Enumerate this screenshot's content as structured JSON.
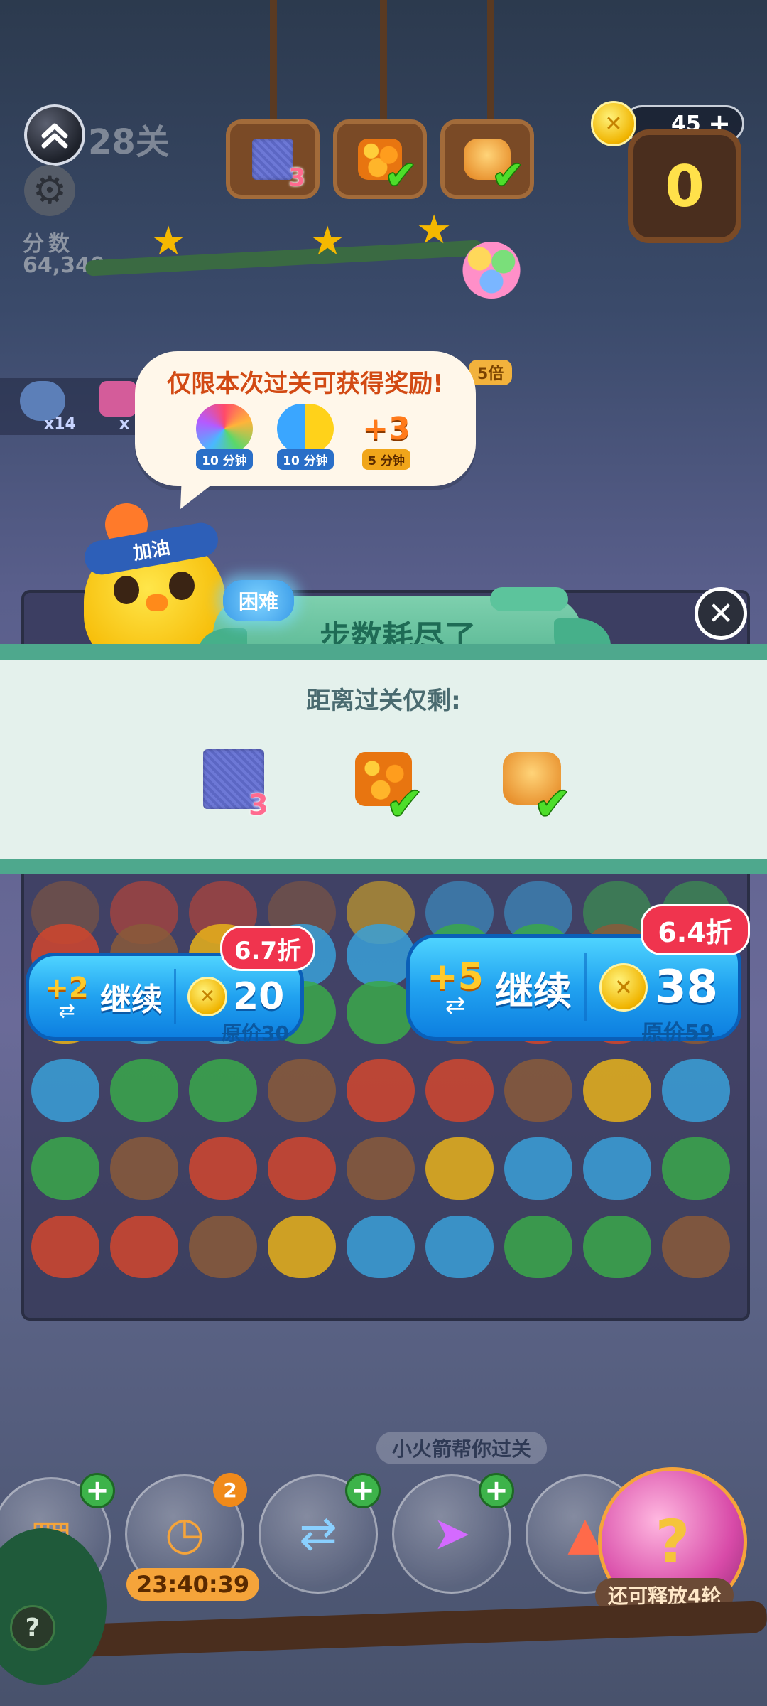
{
  "header": {
    "level": "28关",
    "score_label": "分数",
    "score_value": "64,340",
    "coins": "45",
    "coin_add": "+",
    "moves_left": "0",
    "multiplier": "5倍",
    "goals": [
      {
        "name": "blue-tile",
        "count": "3",
        "done": false
      },
      {
        "name": "orange-block",
        "count": "",
        "done": true
      },
      {
        "name": "cake-block",
        "count": "",
        "done": true
      }
    ]
  },
  "collected": {
    "item1": "x14",
    "item2": "x"
  },
  "reward_bubble": {
    "title": "仅限本次过关可获得奖励!",
    "rewards": [
      {
        "icon": "rainbow-bird-icon",
        "tag": "10 分钟"
      },
      {
        "icon": "swap-chick-icon",
        "tag": "10 分钟"
      },
      {
        "icon": "plus3-moves-icon",
        "label": "+3",
        "tag": "5 分钟"
      }
    ]
  },
  "mascot": {
    "headband": "加油"
  },
  "panel": {
    "difficulty": "困难",
    "title": "步数耗尽了",
    "remain_label": "距离过关仅剩:",
    "goals": [
      {
        "name": "blue-tile",
        "count": "3",
        "done": false
      },
      {
        "name": "orange-block",
        "done": true
      },
      {
        "name": "cake-block",
        "done": true
      }
    ]
  },
  "continue_small": {
    "moves": "+2",
    "label": "继续",
    "price": "20",
    "original": "原价30",
    "discount": "6.7折"
  },
  "continue_big": {
    "moves": "+5",
    "label": "继续",
    "price": "38",
    "original": "原价59",
    "discount": "6.4折"
  },
  "bottom": {
    "hint": "小火箭帮你过关",
    "timer": "23:40:39",
    "timer_badge": "2",
    "release": "还可释放4轮",
    "help": "?"
  },
  "colors": {
    "accent_blue": "#21a2f0",
    "discount_red": "#f0344e",
    "panel_green": "#4ea88d",
    "coin_gold": "#f0b400"
  }
}
